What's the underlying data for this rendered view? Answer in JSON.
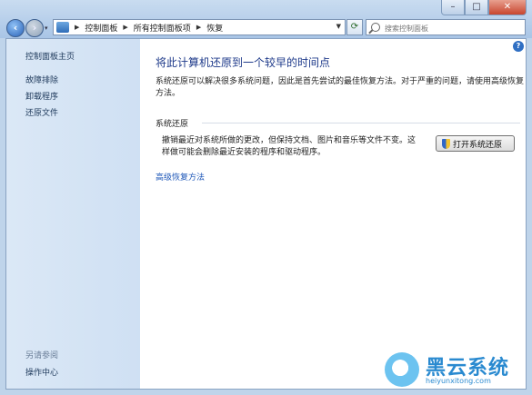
{
  "window": {
    "minimize": "–",
    "maximize": "□",
    "close": "✕"
  },
  "nav": {
    "back": "‹",
    "forward": "›",
    "dropdown": "▾"
  },
  "breadcrumb": [
    "控制面板",
    "所有控制面板项",
    "恢复"
  ],
  "search": {
    "placeholder": "搜索控制面板"
  },
  "sidebar": {
    "items": [
      "控制面板主页",
      "故障排除",
      "卸载程序",
      "还原文件"
    ],
    "see_also_heading": "另请参阅",
    "see_also": [
      "操作中心"
    ]
  },
  "main": {
    "title": "将此计算机还原到一个较早的时间点",
    "intro": "系统还原可以解决很多系统问题，因此是首先尝试的最佳恢复方法。对于严重的问题，请使用高级恢复方法。",
    "section_title": "系统还原",
    "section_desc": "撤销最近对系统所做的更改，但保持文档、图片和音乐等文件不变。这样做可能会删除最近安装的程序和驱动程序。",
    "open_button": "打开系统还原",
    "advanced_link": "高级恢复方法"
  },
  "watermark": {
    "brand": "黑云系统",
    "url": "heiyunxitong.com"
  },
  "colors": {
    "accent": "#1e57b8",
    "sidebar": "#d5e4f4",
    "frame": "#bfd4ea"
  }
}
